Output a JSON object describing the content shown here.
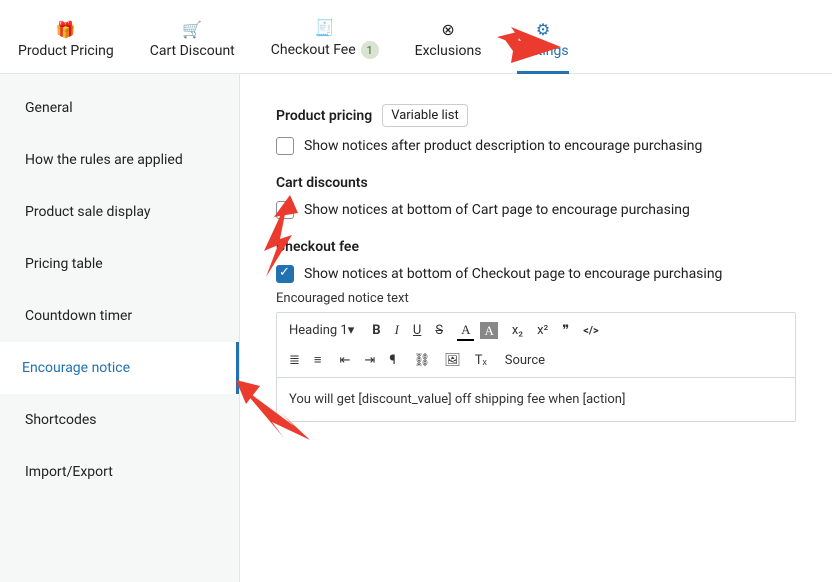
{
  "tabs": {
    "product_pricing": {
      "label": "Product Pricing",
      "icon": "🎁"
    },
    "cart_discount": {
      "label": "Cart Discount",
      "icon": "🛒"
    },
    "checkout_fee": {
      "label": "Checkout Fee",
      "icon": "🧾",
      "badge": "1"
    },
    "exclusions": {
      "label": "Exclusions",
      "icon": "⊗"
    },
    "settings": {
      "label": "Settings",
      "icon": "⚙"
    }
  },
  "sidebar": {
    "items": [
      {
        "label": "General"
      },
      {
        "label": "How the rules are applied"
      },
      {
        "label": "Product sale display"
      },
      {
        "label": "Pricing table"
      },
      {
        "label": "Countdown timer"
      },
      {
        "label": "Encourage notice"
      },
      {
        "label": "Shortcodes"
      },
      {
        "label": "Import/Export"
      }
    ]
  },
  "main": {
    "product_pricing": {
      "title": "Product pricing",
      "chip": "Variable list",
      "checkbox_label": "Show notices after product description to encourage purchasing",
      "checked": false
    },
    "cart_discounts": {
      "title": "Cart discounts",
      "checkbox_label": "Show notices at bottom of Cart page to encourage purchasing",
      "checked": false
    },
    "checkout_fee": {
      "title": "Checkout fee",
      "checkbox_label": "Show notices at bottom of Checkout page to encourage purchasing",
      "checked": true,
      "editor_label": "Encouraged notice text",
      "heading_select": "Heading 1",
      "source_label": "Source",
      "body": "You will get [discount_value] off shipping fee when [action]"
    },
    "editor_buttons": {
      "bold": "B",
      "italic": "I",
      "underline": "U",
      "strike": "S",
      "color": "A",
      "bg": "A",
      "sub": "x₂",
      "sup": "x²",
      "quote": "❞",
      "code": "</>",
      "ol": "≣",
      "ul": "≡",
      "outdent": "⇤",
      "indent": "⇥",
      "para": "¶",
      "link": "⛓",
      "image": "🖼",
      "clear": "Tₓ"
    }
  },
  "colors": {
    "accent": "#2271b1",
    "arrow": "#eb3b2e"
  }
}
